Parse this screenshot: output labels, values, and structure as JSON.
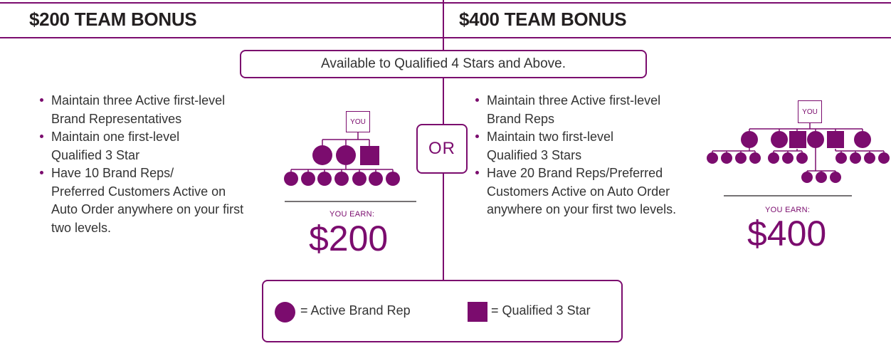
{
  "left_panel": {
    "heading": "$200 TEAM BONUS",
    "bullets": [
      [
        "Maintain three Active first-level",
        "Brand Representatives"
      ],
      [
        "Maintain one first-level",
        "Qualified 3 Star"
      ],
      [
        "Have 10 Brand Reps/",
        "Preferred Customers Active on",
        "Auto Order anywhere on your first",
        "two levels."
      ]
    ],
    "you_label": "YOU",
    "earn_label": "YOU EARN:",
    "earn_amount": "$200"
  },
  "right_panel": {
    "heading": "$400 TEAM BONUS",
    "bullets": [
      [
        "Maintain three Active first-level",
        "Brand Reps"
      ],
      [
        "Maintain two first-level",
        "Qualified 3 Stars"
      ],
      [
        "Have 20 Brand Reps/Preferred",
        "Customers Active on Auto Order",
        "anywhere on your first two levels."
      ]
    ],
    "you_label": "YOU",
    "earn_label": "YOU EARN:",
    "earn_amount": "$400"
  },
  "banner_text": "Available to Qualified 4 Stars and Above.",
  "or_text": "OR",
  "legend": {
    "circle_label": "= Active Brand Rep",
    "square_label": "= Qualified 3 Star"
  },
  "colors": {
    "accent": "#7b0c6e",
    "text": "#333333",
    "heading": "#231f20"
  }
}
